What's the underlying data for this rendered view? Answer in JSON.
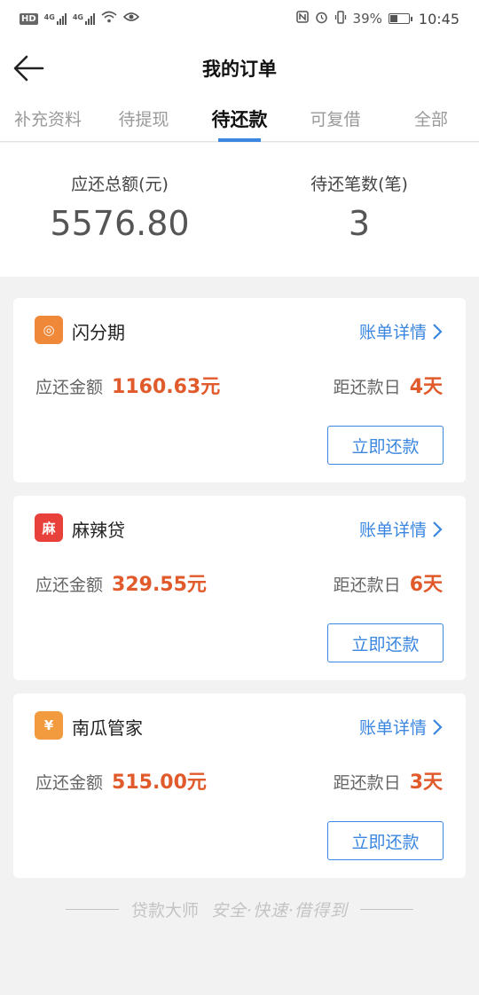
{
  "status_bar": {
    "hd": "HD",
    "net1": "4G",
    "net2": "4G",
    "battery": "39%",
    "time": "10:45"
  },
  "header": {
    "title": "我的订单"
  },
  "tabs": [
    {
      "label": "补充资料"
    },
    {
      "label": "待提现"
    },
    {
      "label": "待还款"
    },
    {
      "label": "可复借"
    },
    {
      "label": "全部"
    }
  ],
  "summary": {
    "total_label": "应还总额(元)",
    "total_value": "5576.80",
    "count_label": "待还笔数(笔)",
    "count_value": "3"
  },
  "orders": [
    {
      "name": "闪分期",
      "detail_label": "账单详情",
      "amount_label": "应还金额",
      "amount": "1160.63元",
      "due_label": "距还款日",
      "due_days": "4天",
      "button": "立即还款",
      "logo_color": "#f0883a",
      "logo_glyph": "◎"
    },
    {
      "name": "麻辣贷",
      "detail_label": "账单详情",
      "amount_label": "应还金额",
      "amount": "329.55元",
      "due_label": "距还款日",
      "due_days": "6天",
      "button": "立即还款",
      "logo_color": "#e8403a",
      "logo_glyph": "麻"
    },
    {
      "name": "南瓜管家",
      "detail_label": "账单详情",
      "amount_label": "应还金额",
      "amount": "515.00元",
      "due_label": "距还款日",
      "due_days": "3天",
      "button": "立即还款",
      "logo_color": "#f29a3e",
      "logo_glyph": "¥"
    }
  ],
  "footer": {
    "brand": "贷款大师",
    "slogan": "安全·快速·借得到"
  },
  "colors": {
    "accent": "#3a86e0",
    "amount": "#e05a2b"
  }
}
